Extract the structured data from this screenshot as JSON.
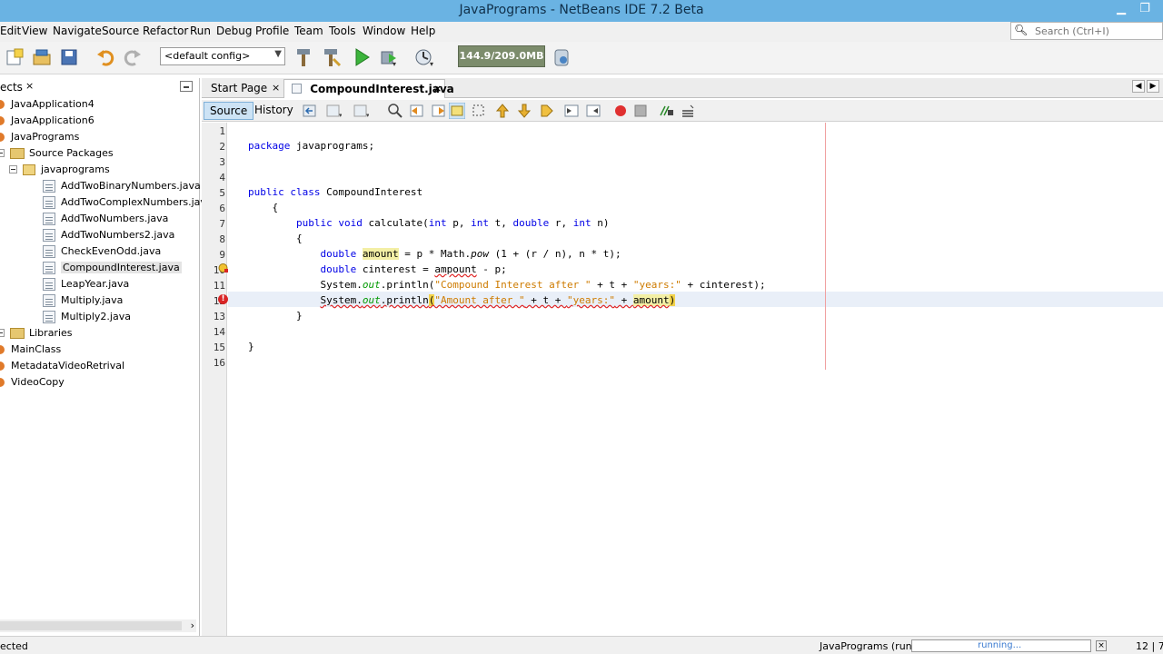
{
  "window": {
    "title": "JavaPrograms - NetBeans IDE 7.2 Beta"
  },
  "menu": {
    "items": [
      "Edit",
      "View",
      "Navigate",
      "Source",
      "Refactor",
      "Run",
      "Debug",
      "Profile",
      "Team",
      "Tools",
      "Window",
      "Help"
    ]
  },
  "search": {
    "placeholder": "Search (Ctrl+I)"
  },
  "toolbar": {
    "config_value": "<default config>",
    "memory_label": "144.9/209.0MB"
  },
  "projects_panel": {
    "tab_label": "ects",
    "close_glyph": "×",
    "tree": [
      {
        "label": "JavaApplication4",
        "kind": "project"
      },
      {
        "label": "JavaApplication6",
        "kind": "project"
      },
      {
        "label": "JavaPrograms",
        "kind": "project"
      },
      {
        "label": "Source Packages",
        "kind": "folder"
      },
      {
        "label": "javaprograms",
        "kind": "package"
      },
      {
        "label": "AddTwoBinaryNumbers.java",
        "kind": "file"
      },
      {
        "label": "AddTwoComplexNumbers.java",
        "kind": "file"
      },
      {
        "label": "AddTwoNumbers.java",
        "kind": "file"
      },
      {
        "label": "AddTwoNumbers2.java",
        "kind": "file"
      },
      {
        "label": "CheckEvenOdd.java",
        "kind": "file"
      },
      {
        "label": "CompoundInterest.java",
        "kind": "file",
        "selected": true
      },
      {
        "label": "LeapYear.java",
        "kind": "file"
      },
      {
        "label": "Multiply.java",
        "kind": "file"
      },
      {
        "label": "Multiply2.java",
        "kind": "file"
      },
      {
        "label": "Libraries",
        "kind": "folder"
      },
      {
        "label": "MainClass",
        "kind": "project"
      },
      {
        "label": "MetadataVideoRetrival",
        "kind": "project"
      },
      {
        "label": "VideoCopy",
        "kind": "project"
      }
    ]
  },
  "editor": {
    "tabs": [
      {
        "label": "Start Page",
        "close": "×"
      },
      {
        "label": "CompoundInterest.java",
        "close": "×"
      }
    ],
    "modes": [
      "Source",
      "History"
    ],
    "line_numbers": [
      "1",
      "2",
      "3",
      "4",
      "5",
      "6",
      "7",
      "8",
      "9",
      "10",
      "11",
      "12",
      "13",
      "14",
      "15",
      "16"
    ],
    "code": {
      "l2": {
        "kw": "package",
        "rest": " javaprograms;"
      },
      "l5": {
        "kw1": "public",
        "kw2": "class",
        "rest": " CompoundInterest"
      },
      "l6": "    {",
      "l7": {
        "kw1": "public",
        "kw2": "void",
        "name": " calculate(",
        "kw3": "int",
        "a": " p, ",
        "kw4": "int",
        "b": " t, ",
        "kw5": "double",
        "c": " r, ",
        "kw6": "int",
        "d": " n)"
      },
      "l8": "        {",
      "l9": {
        "kw": "double",
        "var": "amount",
        "rest1": " = p * Math.",
        "pow": "pow",
        "rest2": " (1 + (r / n), n * t);"
      },
      "l10": {
        "kw": "double",
        "rest1": " cinterest = ",
        "err": "ampount",
        "rest2": " - p;"
      },
      "l11": {
        "sys": "System.",
        "out": "out",
        "p": ".println(",
        "s1": "\"Compound Interest after \"",
        "m": " + t + ",
        "s2": "\"years:\"",
        "e": " + cinterest);"
      },
      "l12": {
        "sys": "System.",
        "out": "out",
        "p": ".println",
        "paren": "(",
        "s1": "\"Amount after \"",
        "m": " + t + ",
        "s2": "\"years:\"",
        "plus": " + ",
        "var": "amount",
        "close": ")"
      },
      "l13": "        }",
      "l15": "}"
    }
  },
  "status": {
    "left": "ected",
    "task": "JavaPrograms (run)",
    "progress": "running...",
    "progress_close": "×",
    "position": "12 | 7"
  }
}
